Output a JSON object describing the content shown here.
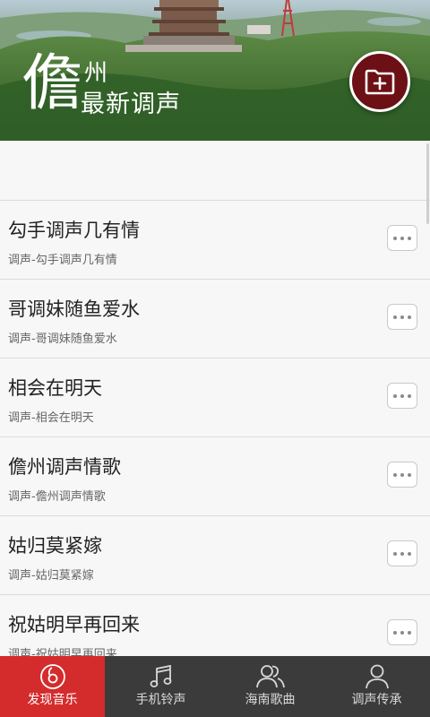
{
  "header": {
    "big_char": "儋",
    "small_char": "州",
    "subtitle": "最新调声",
    "add_button_icon": "folder-plus-icon"
  },
  "songs": [
    {
      "title": "勾手调声几有情",
      "subtitle": "调声-勾手调声几有情"
    },
    {
      "title": "哥调妹随鱼爱水",
      "subtitle": "调声-哥调妹随鱼爱水"
    },
    {
      "title": "相会在明天",
      "subtitle": "调声-相会在明天"
    },
    {
      "title": "儋州调声情歌",
      "subtitle": "调声-儋州调声情歌"
    },
    {
      "title": "姑归莫紧嫁",
      "subtitle": "调声-姑归莫紧嫁"
    },
    {
      "title": "祝姑明早再回来",
      "subtitle": "调声-祝姑明早再回来"
    }
  ],
  "nav": {
    "tabs": [
      {
        "label": "发现音乐",
        "icon": "music-disc-icon",
        "active": true
      },
      {
        "label": "手机铃声",
        "icon": "music-note-icon",
        "active": false
      },
      {
        "label": "海南歌曲",
        "icon": "users-icon",
        "active": false
      },
      {
        "label": "调声传承",
        "icon": "user-icon",
        "active": false
      }
    ]
  },
  "colors": {
    "accent": "#d42c2c",
    "fab": "#6c1015",
    "nav_bg": "#3b3b3b",
    "list_bg": "#f7f7f7"
  }
}
